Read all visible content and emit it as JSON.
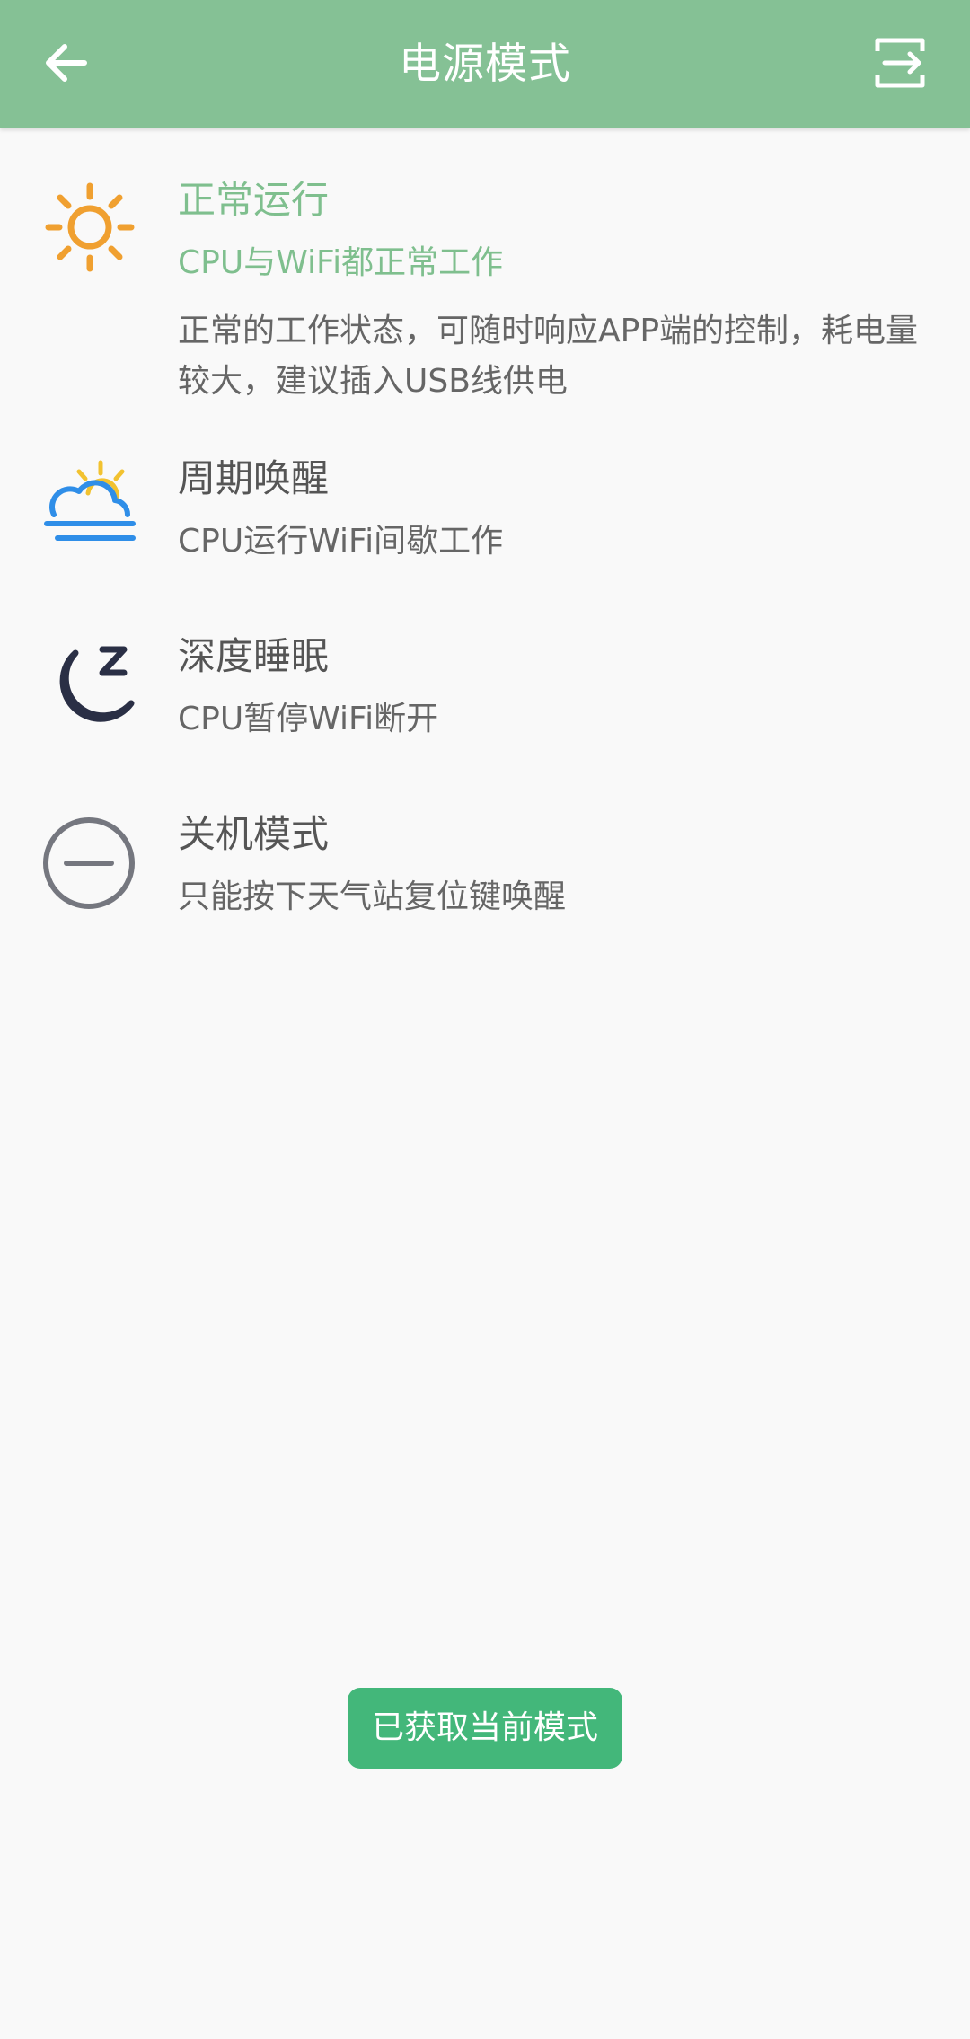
{
  "header": {
    "title": "电源模式",
    "back_icon": "arrow-left-icon",
    "action_icon": "export-icon"
  },
  "modes": [
    {
      "title": "正常运行",
      "subtitle": "CPU与WiFi都正常工作",
      "description": "正常的工作状态，可随时响应APP端的控制，耗电量较大，建议插入USB线供电",
      "icon": "sun-icon",
      "selected": true
    },
    {
      "title": "周期唤醒",
      "subtitle": "CPU运行WiFi间歇工作",
      "icon": "cloud-sun-icon",
      "selected": false
    },
    {
      "title": "深度睡眠",
      "subtitle": "CPU暂停WiFi断开",
      "icon": "moon-sleep-icon",
      "selected": false
    },
    {
      "title": "关机模式",
      "subtitle": "只能按下天气站复位键唤醒",
      "icon": "minus-circle-icon",
      "selected": false
    }
  ],
  "toast": {
    "message": "已获取当前模式"
  },
  "colors": {
    "appbar": "#85c195",
    "selected_text": "#7fbf8e",
    "toast": "#43b77a",
    "sun": "#f0a030",
    "cloud": "#2f8ee8",
    "moon_fill": "#6ee6a8",
    "moon_outline": "#2a2f45"
  }
}
